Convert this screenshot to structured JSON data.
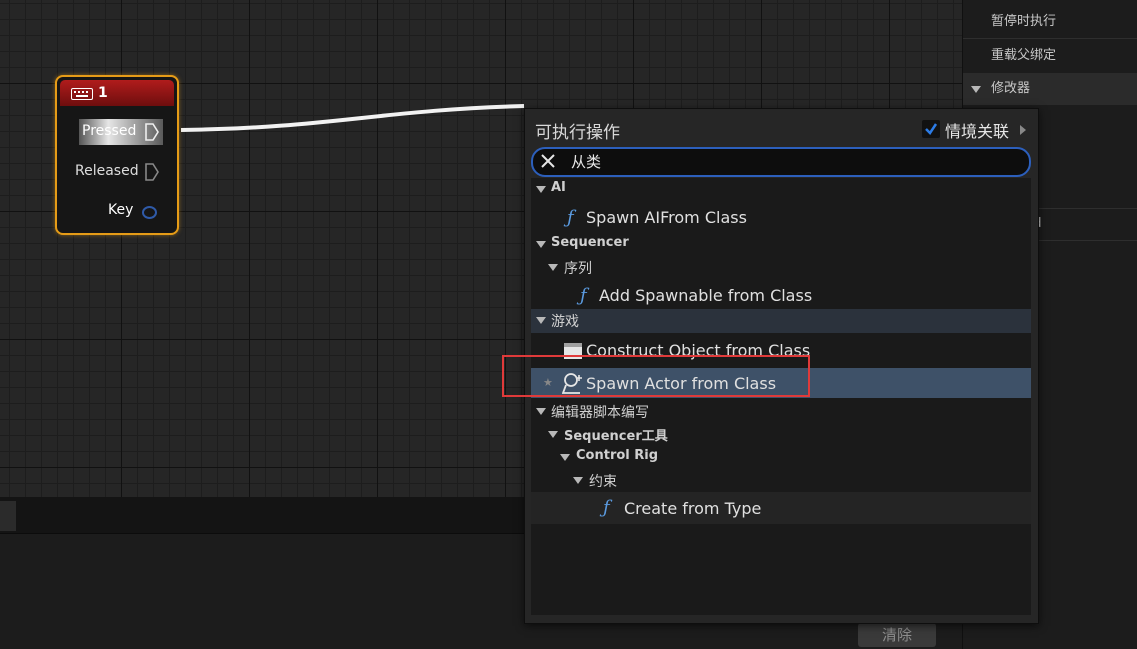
{
  "right_panel": {
    "rows": [
      "暂停时执行",
      "重载父绑定"
    ],
    "header": "修改器",
    "partial": "nd"
  },
  "node": {
    "title": "1",
    "pins": {
      "pressed": "Pressed",
      "released": "Released",
      "key": "Key"
    }
  },
  "menu": {
    "title": "可执行操作",
    "context_label": "情境关联",
    "context_checked": true,
    "search_value": "从类",
    "items": [
      {
        "text": "AI"
      },
      {
        "text": "Spawn AIFrom Class"
      },
      {
        "text": "Sequencer"
      },
      {
        "text": "序列"
      },
      {
        "text": "Add Spawnable from Class"
      },
      {
        "text": "游戏"
      },
      {
        "text": "Construct Object from Class"
      },
      {
        "text": "Spawn Actor from Class"
      },
      {
        "text": "编辑器脚本编写"
      },
      {
        "text": "Sequencer工具"
      },
      {
        "text": "Control Rig"
      },
      {
        "text": "约束"
      },
      {
        "text": "Create from Type"
      }
    ]
  },
  "bottom": {
    "clear_label": "清除"
  },
  "colors": {
    "accent": "#2c5fbc",
    "node_border": "#e69c17",
    "highlight": "#e03a3a",
    "selected": "#3e5168"
  }
}
